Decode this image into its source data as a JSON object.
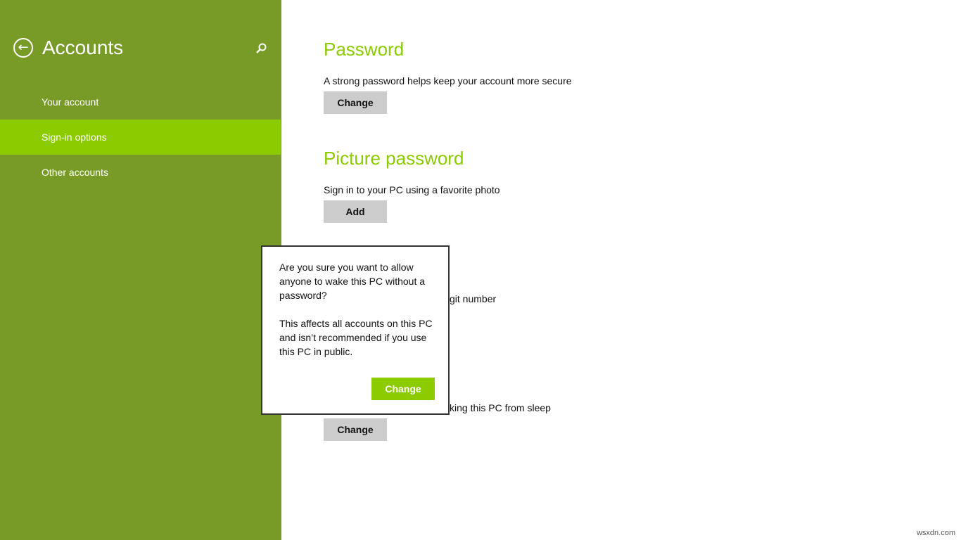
{
  "sidebar": {
    "title": "Accounts",
    "back_icon": "back-arrow-icon",
    "search_icon": "search-icon",
    "items": [
      {
        "label": "Your account"
      },
      {
        "label": "Sign-in options",
        "active": true
      },
      {
        "label": "Other accounts"
      }
    ]
  },
  "main": {
    "password": {
      "heading": "Password",
      "description": "A strong password helps keep your account more secure",
      "button": "Change"
    },
    "picture_password": {
      "heading": "Picture password",
      "description": "Sign in to your PC using a favorite photo",
      "button": "Add"
    },
    "pin": {
      "description_fragment": "git number"
    },
    "policy": {
      "description_fragment": "king this PC from sleep",
      "button": "Change"
    }
  },
  "dialog": {
    "message": "Are you sure you want to allow anyone to wake this PC without a password?",
    "detail": "This affects all accounts on this PC and isn’t recommended if you use this PC in public.",
    "button": "Change"
  },
  "watermark": "wsxdn.com",
  "colors": {
    "sidebar": "#789b27",
    "accent": "#8bcb00",
    "button": "#cccccc"
  }
}
